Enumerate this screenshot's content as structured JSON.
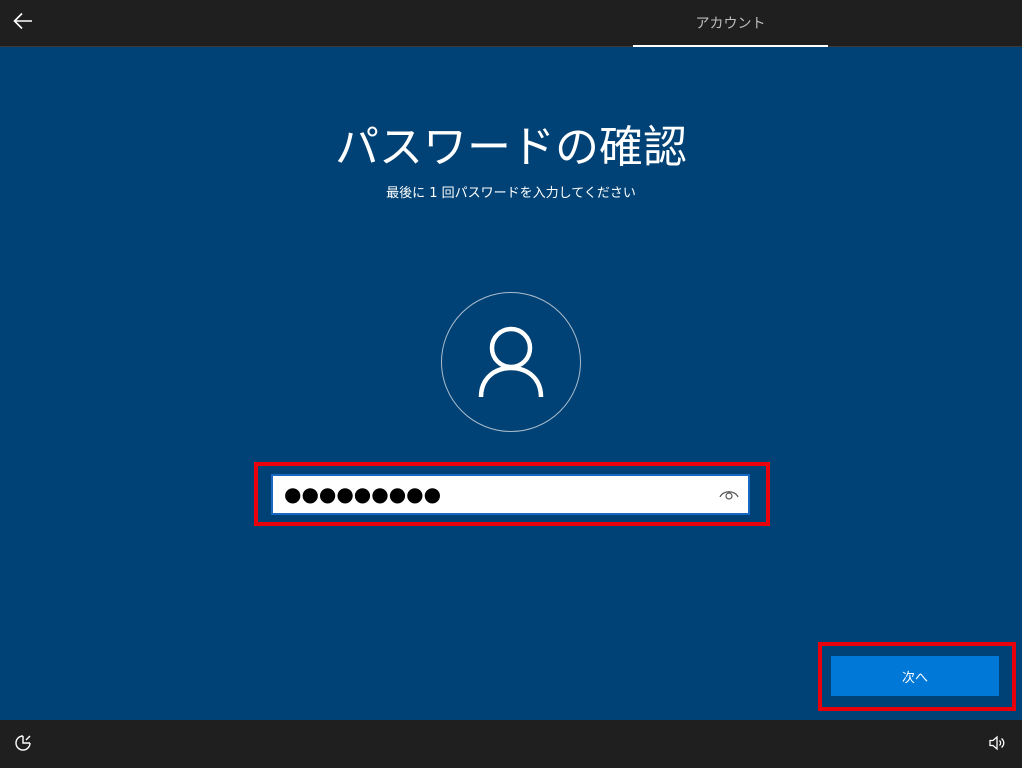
{
  "header": {
    "back_icon": "arrow-left-icon",
    "tab_label": "アカウント"
  },
  "main": {
    "title": "パスワードの確認",
    "subtitle": "最後に 1 回パスワードを入力してください",
    "avatar_icon": "user-icon",
    "password": {
      "value": "●●●●●●●●●",
      "reveal_icon": "eye-icon"
    },
    "next_label": "次へ"
  },
  "footer": {
    "ease_of_access_icon": "ease-of-access-icon",
    "volume_icon": "volume-icon"
  },
  "colors": {
    "background": "#004275",
    "bar": "#1f1f1f",
    "accent": "#0078d7",
    "highlight": "#e8000b"
  }
}
